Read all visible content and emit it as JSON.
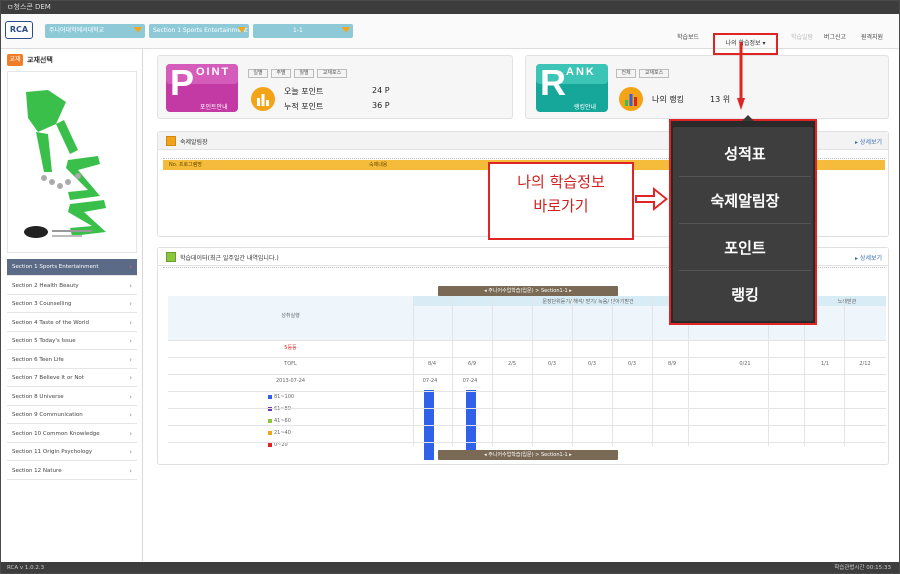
{
  "titlebar": {
    "title": "ㅁ청스콘 DEM"
  },
  "topbar": {
    "logo": "RCA",
    "combos": [
      "주니어대학에서대학교",
      "Section 1 Sports Entertainment",
      "1-1"
    ],
    "links": [
      "학습보드",
      "나의 학습정보",
      "학습일람",
      "버그신고",
      "원격지원"
    ],
    "mystudy_label": "나의 학습정보"
  },
  "sidebar": {
    "header_badge": "교재",
    "header_label": "교재선택",
    "sections": [
      "Section 1 Sports Entertainment",
      "Section 2 Health Beauty",
      "Section 3 Counselling",
      "Section 4 Taste of the World",
      "Section 5 Today's Issue",
      "Section 6 Teen Life",
      "Section 7 Believe It or Not",
      "Section 8 Universe",
      "Section 9 Communication",
      "Section 10 Common Knowledge",
      "Section 11 Origin Psychology",
      "Section 12 Nature"
    ],
    "active_index": 0,
    "chevron": "›"
  },
  "point_card": {
    "big_letter": "P",
    "word": "OINT",
    "sub": "포인트안내",
    "buttons": [
      "일별",
      "주별",
      "월별",
      "교재포스"
    ],
    "stats": [
      {
        "label": "오늘 포인트",
        "value": "24 P"
      },
      {
        "label": "누적 포인트",
        "value": "36 P"
      }
    ]
  },
  "rank_card": {
    "big_letter": "R",
    "word": "ANK",
    "sub": "랭킹안내",
    "buttons": [
      "전체",
      "교재포스"
    ],
    "stat_label": "나의 랭킹",
    "stat_value": "13 위"
  },
  "homework_panel": {
    "title": "숙제알림장",
    "more": "▸ 상세보기",
    "col1": "No.  프로그램명",
    "col2": "숙제내용"
  },
  "results_panel": {
    "title": "학습데이터(최근 일주일간 내역입니다.)",
    "more": "▸ 상세보기",
    "nav_label": "주니어수업학습(입문) > Section1-1",
    "row_head": "성취실행",
    "group_label": "문장단위듣기/ 해석/ 받기/ 녹음/ 받아기받건",
    "last_group": "노래받관",
    "rows": [
      "5등등",
      "TOFL",
      "2013-07-24"
    ],
    "legend": [
      {
        "label": "81~100",
        "color": "#2f62e8"
      },
      {
        "label": "61~80",
        "color": "#6a38b8"
      },
      {
        "label": "41~60",
        "color": "#8cc63f"
      },
      {
        "label": "21~40",
        "color": "#f0a31c"
      },
      {
        "label": "0~20",
        "color": "#e02424"
      }
    ],
    "vals": [
      "8/4",
      "6/9",
      "2/5",
      "0/3",
      "0/3",
      "0/3",
      "8/9",
      "0/21",
      "1/1",
      "2/12"
    ],
    "dates": [
      "07-24",
      "07-24"
    ]
  },
  "popup": {
    "items": [
      "성적표",
      "숙제알림장",
      "포인트",
      "랭킹"
    ]
  },
  "callout": {
    "line1": "나의 학습정보",
    "line2": "바로가기"
  },
  "statusbar": {
    "left": "RCA v 1.0.2.3",
    "right": "학습관법시간 00:15:33"
  }
}
